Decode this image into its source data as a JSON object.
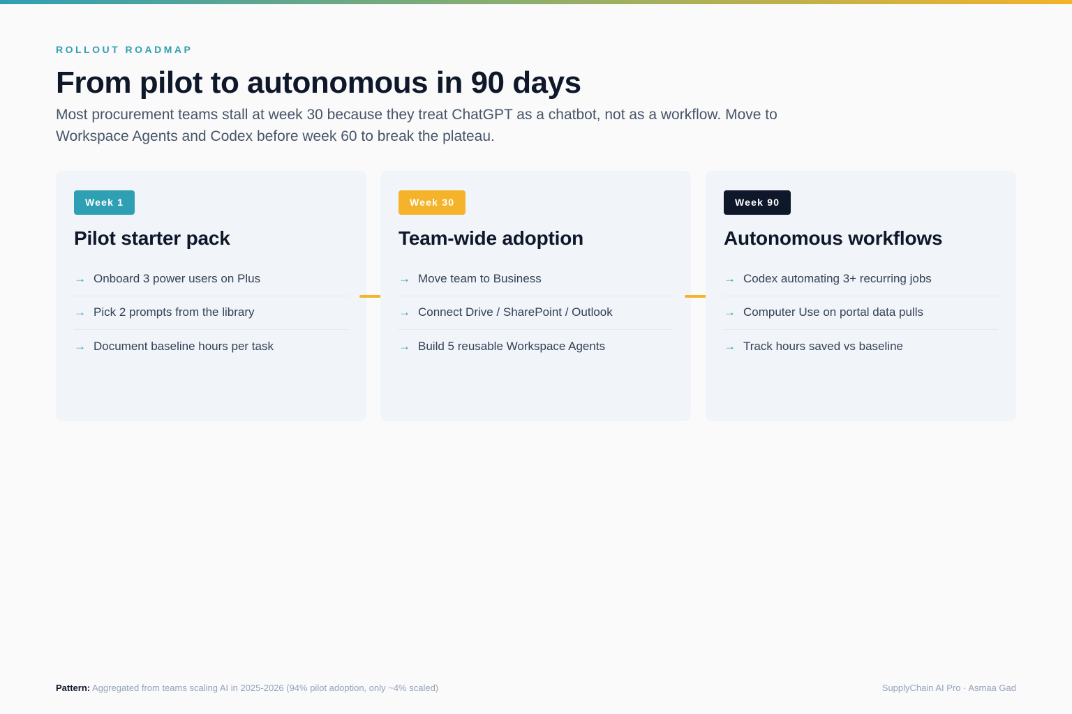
{
  "colors": {
    "teal": "#2f9fb3",
    "amber": "#f4b32a",
    "navy": "#0f172a",
    "card_bg": "#f1f4f9"
  },
  "header": {
    "eyebrow": "ROLLOUT ROADMAP",
    "title": "From pilot to autonomous in 90 days",
    "subtitle": "Most procurement teams stall at week 30 because they treat ChatGPT as a chatbot, not as a workflow. Move to Workspace Agents and Codex before week 60 to break the plateau."
  },
  "cards": [
    {
      "badge": "Week 1",
      "title": "Pilot starter pack",
      "items": [
        "Onboard 3 power users on Plus",
        "Pick 2 prompts from the library",
        "Document baseline hours per task"
      ]
    },
    {
      "badge": "Week 30",
      "title": "Team-wide adoption",
      "items": [
        "Move team to Business",
        "Connect Drive / SharePoint / Outlook",
        "Build 5 reusable Workspace Agents"
      ]
    },
    {
      "badge": "Week 90",
      "title": "Autonomous workflows",
      "items": [
        "Codex automating 3+ recurring jobs",
        "Computer Use on portal data pulls",
        "Track hours saved vs baseline"
      ]
    }
  ],
  "arrow_glyph": "→",
  "footer": {
    "pattern_label": "Pattern:",
    "pattern_text": " Aggregated from teams scaling AI in 2025-2026 (94% pilot adoption, only ~4% scaled)",
    "credit": "SupplyChain AI Pro · Asmaa Gad"
  }
}
